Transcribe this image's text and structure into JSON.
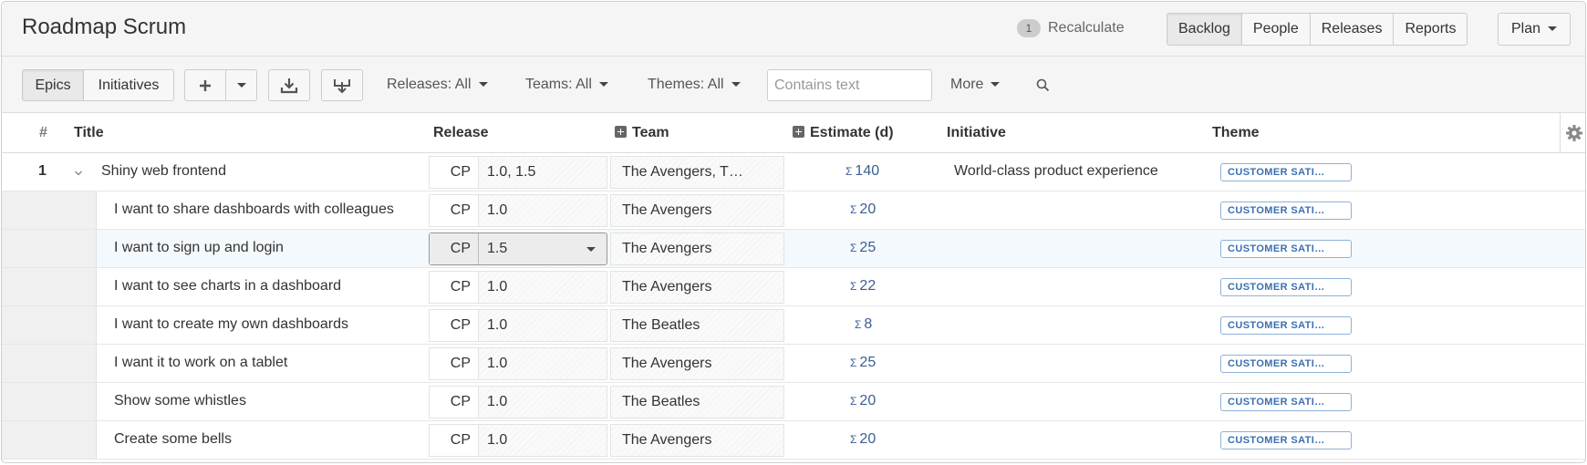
{
  "header": {
    "title": "Roadmap Scrum",
    "recalc_count": "1",
    "recalc_label": "Recalculate",
    "tabs": [
      {
        "label": "Backlog",
        "active": true
      },
      {
        "label": "People",
        "active": false
      },
      {
        "label": "Releases",
        "active": false
      },
      {
        "label": "Reports",
        "active": false
      }
    ],
    "plan_label": "Plan"
  },
  "toolbar": {
    "view_toggle": [
      {
        "label": "Epics",
        "active": true
      },
      {
        "label": "Initiatives",
        "active": false
      }
    ],
    "add_icon": "plus-icon",
    "download_icon": "download-icon",
    "import_icon": "import-icon",
    "filters": {
      "releases": "Releases: All",
      "teams": "Teams: All",
      "themes": "Themes: All",
      "more": "More"
    },
    "search_placeholder": "Contains text",
    "search_icon": "search-icon"
  },
  "table": {
    "columns": {
      "rank": "#",
      "title": "Title",
      "release": "Release",
      "team": "Team",
      "estimate": "Estimate (d)",
      "initiative": "Initiative",
      "theme": "Theme"
    },
    "settings_icon": "gear-icon",
    "sigma": "Σ",
    "rows": [
      {
        "rank": "1",
        "title": "Shiny web frontend",
        "release_prefix": "CP",
        "release": "1.0, 1.5",
        "team": "The Avengers, T…",
        "estimate": "140",
        "initiative": "World-class product experience",
        "theme": "CUSTOMER SATI…"
      },
      {
        "rank": "",
        "title": "I want to share dashboards with colleagues",
        "release_prefix": "CP",
        "release": "1.0",
        "team": "The Avengers",
        "estimate": "20",
        "initiative": "",
        "theme": "CUSTOMER SATI…"
      },
      {
        "rank": "",
        "title": "I want to sign up and login",
        "release_prefix": "CP",
        "release": "1.5",
        "team": "The Avengers",
        "estimate": "25",
        "initiative": "",
        "theme": "CUSTOMER SATI…"
      },
      {
        "rank": "",
        "title": "I want to see charts in a dashboard",
        "release_prefix": "CP",
        "release": "1.0",
        "team": "The Avengers",
        "estimate": "22",
        "initiative": "",
        "theme": "CUSTOMER SATI…"
      },
      {
        "rank": "",
        "title": "I want to create my own dashboards",
        "release_prefix": "CP",
        "release": "1.0",
        "team": "The Beatles",
        "estimate": "8",
        "initiative": "",
        "theme": "CUSTOMER SATI…"
      },
      {
        "rank": "",
        "title": "I want it to work on a tablet",
        "release_prefix": "CP",
        "release": "1.0",
        "team": "The Avengers",
        "estimate": "25",
        "initiative": "",
        "theme": "CUSTOMER SATI…"
      },
      {
        "rank": "",
        "title": "Show some whistles",
        "release_prefix": "CP",
        "release": "1.0",
        "team": "The Beatles",
        "estimate": "20",
        "initiative": "",
        "theme": "CUSTOMER SATI…"
      },
      {
        "rank": "",
        "title": "Create some bells",
        "release_prefix": "CP",
        "release": "1.0",
        "team": "The Avengers",
        "estimate": "20",
        "initiative": "",
        "theme": "CUSTOMER SATI…"
      }
    ]
  },
  "colors": {
    "accent_link": "#3a5f91",
    "badge_border": "#8fb1d8",
    "badge_text": "#3a6fb0",
    "row_highlight": "#f4f9fd"
  }
}
